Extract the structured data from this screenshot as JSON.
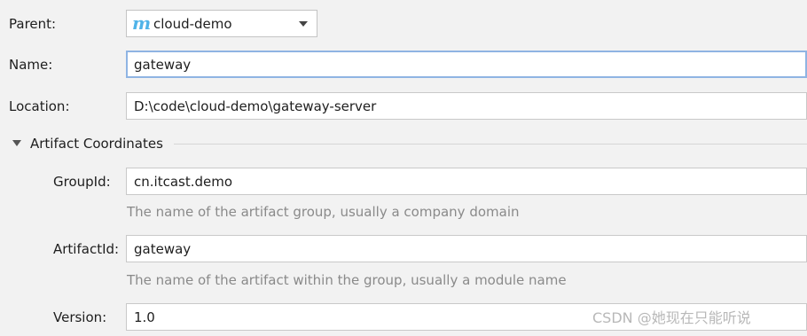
{
  "parent": {
    "label": "Parent:",
    "value": "cloud-demo",
    "icon_letter": "m",
    "icon_color": "#4fb3e8"
  },
  "name": {
    "label": "Name:",
    "value": "gateway"
  },
  "location": {
    "label": "Location:",
    "value": "D:\\code\\cloud-demo\\gateway-server"
  },
  "artifact": {
    "section_title": "Artifact Coordinates",
    "group_id": {
      "label": "GroupId:",
      "value": "cn.itcast.demo",
      "hint": "The name of the artifact group, usually a company domain"
    },
    "artifact_id": {
      "label": "ArtifactId:",
      "value": "gateway",
      "hint": "The name of the artifact within the group, usually a module name"
    },
    "version": {
      "label": "Version:",
      "value": "1.0"
    }
  },
  "watermark": "CSDN @她现在只能听说"
}
